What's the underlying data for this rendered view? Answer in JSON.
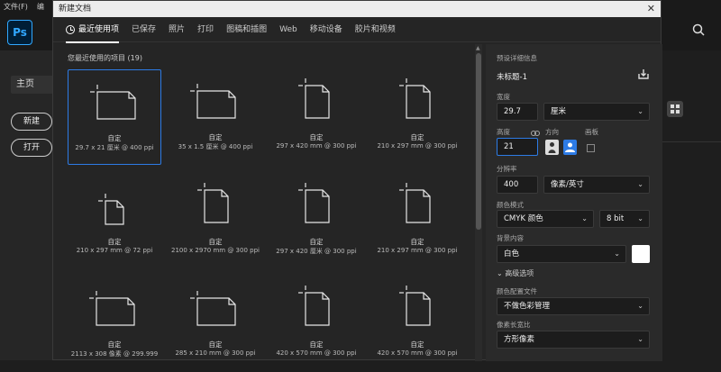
{
  "ps": {
    "menu": [
      "文件(F)",
      "编"
    ],
    "logo": "Ps",
    "home": "主页",
    "new_btn": "新建",
    "open_btn": "打开"
  },
  "dialog": {
    "title": "新建文档",
    "close": "✕",
    "tabs": [
      {
        "label": "最近使用项",
        "active": true
      },
      {
        "label": "已保存"
      },
      {
        "label": "照片"
      },
      {
        "label": "打印"
      },
      {
        "label": "图稿和插图"
      },
      {
        "label": "Web"
      },
      {
        "label": "移动设备"
      },
      {
        "label": "胶片和视频"
      }
    ],
    "recent_label": "您最近使用的项目 (19)",
    "items": [
      {
        "name": "自定",
        "desc": "29.7 x 21 厘米 @ 400 ppi",
        "orient": "landscape",
        "selected": true
      },
      {
        "name": "自定",
        "desc": "35 x 1.5 厘米 @ 400 ppi",
        "orient": "landscape"
      },
      {
        "name": "自定",
        "desc": "297 x 420 mm @ 300 ppi",
        "orient": "portrait"
      },
      {
        "name": "自定",
        "desc": "210 x 297 mm @ 300 ppi",
        "orient": "portrait"
      },
      {
        "name": "自定",
        "desc": "210 x 297 mm @ 72 ppi",
        "orient": "portrait-small"
      },
      {
        "name": "自定",
        "desc": "2100 x 2970 mm @ 300 ppi",
        "orient": "portrait"
      },
      {
        "name": "自定",
        "desc": "297 x 420 厘米 @ 300 ppi",
        "orient": "portrait"
      },
      {
        "name": "自定",
        "desc": "210 x 297 mm @ 300 ppi",
        "orient": "portrait"
      },
      {
        "name": "自定",
        "desc": "2113 x 308 像素 @ 299.999",
        "orient": "landscape"
      },
      {
        "name": "自定",
        "desc": "285 x 210 mm @ 300 ppi",
        "orient": "landscape"
      },
      {
        "name": "自定",
        "desc": "420 x 570 mm @ 300 ppi",
        "orient": "portrait"
      },
      {
        "name": "自定",
        "desc": "420 x 570 mm @ 300 ppi",
        "orient": "portrait"
      }
    ]
  },
  "panel": {
    "preset_label": "预设详细信息",
    "preset_name": "未标题-1",
    "width_label": "宽度",
    "width_value": "29.7",
    "width_unit": "厘米",
    "height_label": "高度",
    "height_value": "21",
    "orient_label": "方向",
    "artboard_label": "画板",
    "res_label": "分辨率",
    "res_value": "400",
    "res_unit": "像素/英寸",
    "color_mode_label": "颜色模式",
    "color_mode_value": "CMYK 颜色",
    "bit_depth": "8 bit",
    "bg_label": "背景内容",
    "bg_value": "白色",
    "advanced": "高级选项",
    "profile_label": "颜色配置文件",
    "profile_value": "不做色彩管理",
    "pixel_ratio_label": "像素长宽比",
    "pixel_ratio_value": "方形像素"
  },
  "colors": {
    "accent": "#2d7be5",
    "swatch": "#ffffff"
  }
}
